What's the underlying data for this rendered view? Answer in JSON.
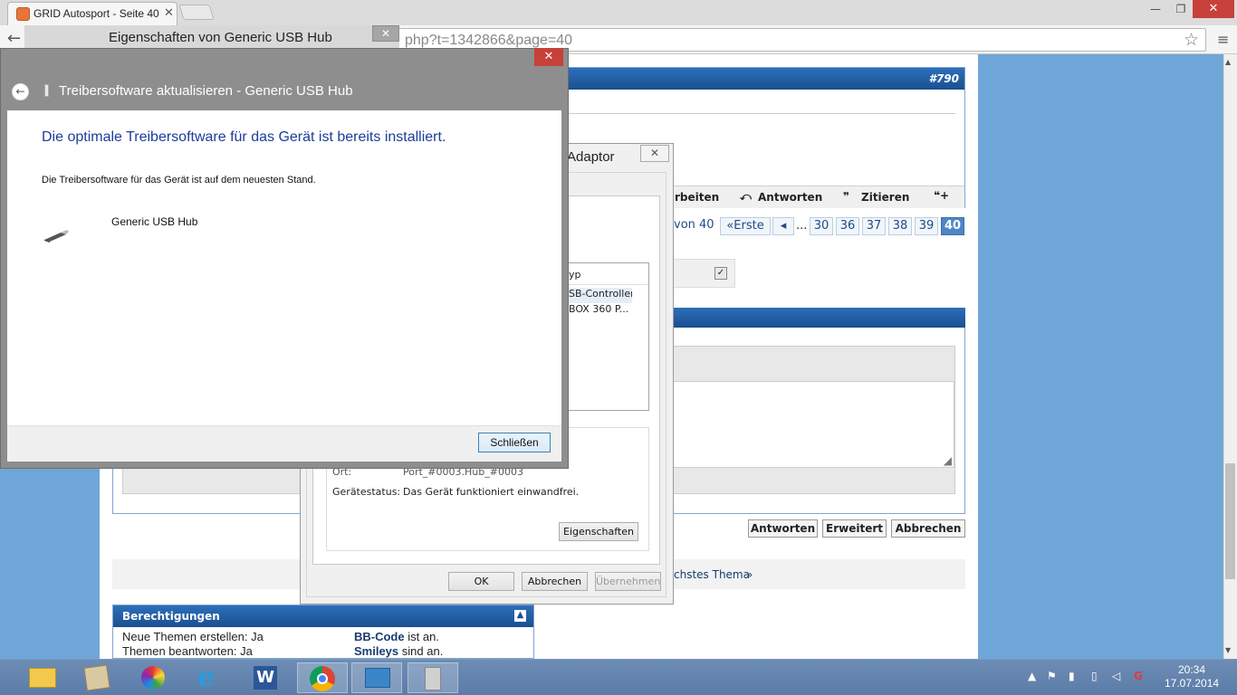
{
  "browser": {
    "tab_title": "GRID Autosport - Seite 40",
    "tab_close": "✕",
    "url_visible": "php?t=1342866&page=40",
    "minimize": "—",
    "maximize": "❐",
    "close": "✕"
  },
  "forum": {
    "post_number": "#790",
    "post_actions": [
      "rbeiten",
      "Antworten",
      "Zitieren"
    ],
    "pagination": {
      "label": "von 40",
      "first": "Erste",
      "prev": "◂",
      "ellipsis": "...",
      "pages": [
        "30",
        "36",
        "37",
        "38",
        "39"
      ],
      "current": "40"
    },
    "reply_buttons": [
      "Antworten",
      "Erweitert",
      "Abbrechen"
    ],
    "next_thread": "chstes Thema",
    "next_thread_arrow": "»",
    "permissions": {
      "title": "Berechtigungen",
      "toggle": "▲",
      "lines_left": [
        "Neue Themen erstellen: Ja",
        "Themen beantworten: Ja"
      ],
      "bb_code": "BB-Code",
      "bb_code_suffix": "ist an.",
      "smileys": "Smileys",
      "smileys_suffix": "sind an."
    }
  },
  "properties_dialog": {
    "title_visible": "Adaptor",
    "close": "✕",
    "list_header": "yp",
    "list_rows": [
      "SB-Controller",
      "BOX 360 P..."
    ],
    "location_label": "Ort:",
    "location_value": "Port_#0003.Hub_#0003",
    "status_label": "Gerätestatus:",
    "status_value": "Das Gerät funktioniert einwandfrei.",
    "eigenschaften_button": "Eigenschaften",
    "ok": "OK",
    "cancel": "Abbrechen",
    "apply": "Übernehmen"
  },
  "background_window": {
    "title": "Eigenschaften von Generic USB Hub",
    "close": "✕"
  },
  "driver_dialog": {
    "header": "Treibersoftware aktualisieren - Generic USB Hub",
    "close": "✕",
    "back": "←",
    "message": "Die optimale Treibersoftware für das Gerät ist bereits installiert.",
    "submessage": "Die Treibersoftware für das Gerät ist auf dem neuesten Stand.",
    "device_name": "Generic USB Hub",
    "close_button": "Schließen"
  },
  "taskbar": {
    "icons": [
      "file-explorer-icon",
      "device-manager-icon",
      "picasa-icon",
      "internet-explorer-icon",
      "word-icon",
      "chrome-icon",
      "control-panel-icon",
      "usb-device-icon"
    ],
    "time": "20:34",
    "date": "17.07.2014"
  },
  "colors": {
    "forum_blue": "#1a4f90",
    "dialog_link_blue": "#1c3d99",
    "close_red": "#c7403a",
    "taskbar": "#5b7ca8"
  }
}
